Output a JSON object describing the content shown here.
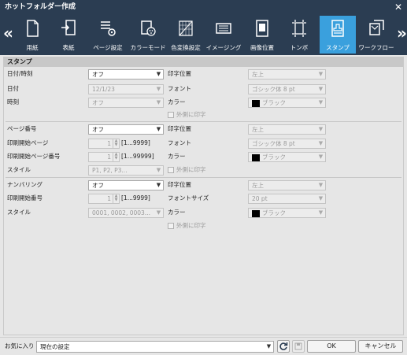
{
  "window": {
    "title": "ホットフォルダー作成",
    "close_glyph": "✕"
  },
  "toolbar": {
    "prev_glyph": "«",
    "next_glyph": "»",
    "tabs": [
      {
        "label": "用紙",
        "icon": "paper-icon"
      },
      {
        "label": "表紙",
        "icon": "cover-icon"
      },
      {
        "label": "ページ設定",
        "icon": "page-settings-icon"
      },
      {
        "label": "カラーモード",
        "icon": "color-mode-icon"
      },
      {
        "label": "色変換設定",
        "icon": "color-conversion-icon"
      },
      {
        "label": "イメージング",
        "icon": "imaging-icon"
      },
      {
        "label": "画像位置",
        "icon": "image-position-icon"
      },
      {
        "label": "トンボ",
        "icon": "crop-marks-icon"
      },
      {
        "label": "スタンプ",
        "icon": "stamp-icon"
      },
      {
        "label": "ワークフロー",
        "icon": "workflow-icon"
      }
    ],
    "active_tab": "スタンプ",
    "accent_color": "#3aa0dd"
  },
  "section": {
    "title": "スタンプ"
  },
  "datetime": {
    "label_datetime": "日付/時刻",
    "datetime_value": "オフ",
    "label_date": "日付",
    "date_value": "12/1/23",
    "label_time": "時刻",
    "time_value": "オフ",
    "label_position": "印字位置",
    "position_value": "左上",
    "label_font": "フォント",
    "font_value": "ゴシック体 8 pt",
    "label_color": "カラー",
    "color_value": "ブラック",
    "outside_label": "外側に印字"
  },
  "page_number": {
    "label_page": "ページ番号",
    "page_value": "オフ",
    "label_start_page": "印刷開始ページ",
    "start_page_value": "1",
    "start_page_range": "[1...9999]",
    "label_start_number": "印刷開始ページ番号",
    "start_number_value": "1",
    "start_number_range": "[1...99999]",
    "label_style": "スタイル",
    "style_value": "P1, P2, P3...",
    "label_position": "印字位置",
    "position_value": "左上",
    "label_font": "フォント",
    "font_value": "ゴシック体 8 pt",
    "label_color": "カラー",
    "color_value": "ブラック",
    "outside_label": "外側に印字"
  },
  "numbering": {
    "label_numbering": "ナンバリング",
    "numbering_value": "オフ",
    "label_start_number": "印刷開始番号",
    "start_number_value": "1",
    "start_number_range": "[1...9999]",
    "label_style": "スタイル",
    "style_value": "0001, 0002, 0003...",
    "label_position": "印字位置",
    "position_value": "左上",
    "label_font_size": "フォントサイズ",
    "font_size_value": "20 pt",
    "label_color": "カラー",
    "color_value": "ブラック",
    "outside_label": "外側に印字"
  },
  "footer": {
    "favorites_label": "お気に入り",
    "favorites_value": "現在の設定",
    "ok_label": "OK",
    "cancel_label": "キャンセル"
  }
}
